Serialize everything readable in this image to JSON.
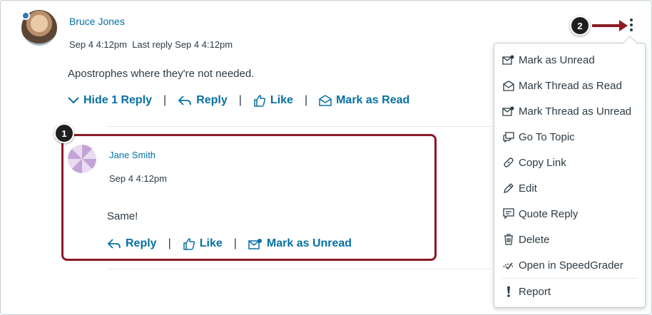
{
  "post": {
    "author": "Bruce Jones",
    "posted": "Sep 4 4:12pm",
    "last_reply": "Last reply Sep 4 4:12pm",
    "message": "Apostrophes where they're not needed.",
    "actions": {
      "hide_replies": "Hide 1 Reply",
      "reply": "Reply",
      "like": "Like",
      "mark": "Mark as Read"
    }
  },
  "reply": {
    "author": "Jane Smith",
    "posted": "Sep 4 4:12pm",
    "message": "Same!",
    "actions": {
      "reply": "Reply",
      "like": "Like",
      "mark": "Mark as Unread"
    }
  },
  "separator": "|",
  "callouts": {
    "one": "1",
    "two": "2"
  },
  "menu": {
    "items": [
      {
        "label": "Mark as Unread",
        "icon": "mail-unread-icon"
      },
      {
        "label": "Mark Thread as Read",
        "icon": "mail-open-icon"
      },
      {
        "label": "Mark Thread as Unread",
        "icon": "mail-unread-icon"
      },
      {
        "label": "Go To Topic",
        "icon": "discussion-icon"
      },
      {
        "label": "Copy Link",
        "icon": "link-icon"
      },
      {
        "label": "Edit",
        "icon": "pencil-icon"
      },
      {
        "label": "Quote Reply",
        "icon": "quote-icon"
      },
      {
        "label": "Delete",
        "icon": "trash-icon"
      },
      {
        "label": "Open in SpeedGrader",
        "icon": "speedgrader-icon"
      },
      {
        "label": "Report",
        "icon": "exclamation-icon"
      }
    ]
  },
  "colors": {
    "link": "#0770a3",
    "callout_red": "#8b1a24",
    "text": "#2d3b45",
    "unread_dot": "#2b7abc"
  }
}
